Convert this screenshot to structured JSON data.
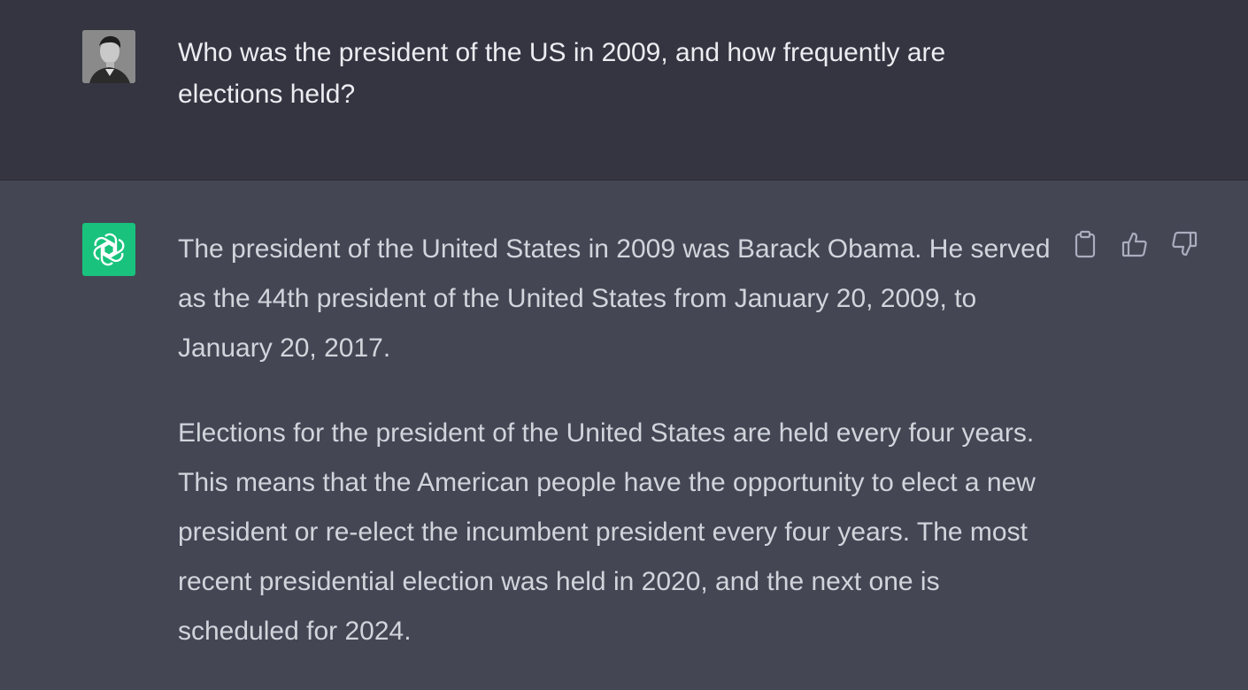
{
  "conversation": {
    "user_message": {
      "text": "Who was the president of the US in 2009, and how frequently are elections held?",
      "avatar": "user-photo"
    },
    "assistant_message": {
      "avatar": "openai-logo-icon",
      "avatar_color": "#19c37d",
      "paragraphs": [
        "The president of the United States in 2009 was Barack Obama. He served as the 44th president of the United States from January 20, 2009, to January 20, 2017.",
        "Elections for the president of the United States are held every four years. This means that the American people have the opportunity to elect a new president or re-elect the incumbent president every four years. The most recent presidential election was held in 2020, and the next one is scheduled for 2024."
      ],
      "actions": [
        {
          "name": "copy",
          "icon": "clipboard-icon"
        },
        {
          "name": "thumbs-up",
          "icon": "thumbs-up-icon"
        },
        {
          "name": "thumbs-down",
          "icon": "thumbs-down-icon"
        }
      ]
    }
  },
  "colors": {
    "user_bg": "#343541",
    "assistant_bg": "#444654",
    "user_text": "#ececf1",
    "assistant_text": "#d1d5db",
    "icon": "#acacbe"
  }
}
